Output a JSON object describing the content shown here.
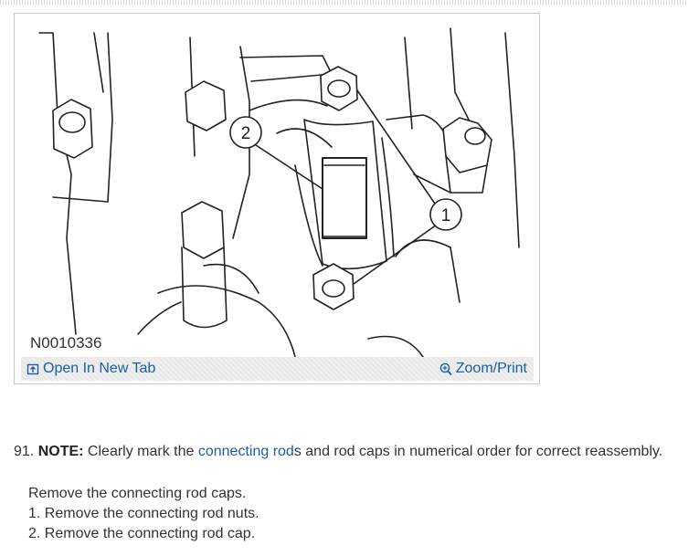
{
  "figure": {
    "image_id": "N0010336",
    "callouts": [
      "1",
      "2"
    ],
    "open_link": "Open In New Tab",
    "zoom_link": "Zoom/Print"
  },
  "step": {
    "number": "91.",
    "note_label": "NOTE:",
    "text_before": " Clearly mark the ",
    "link_text": "connecting rod",
    "text_after": "s and rod caps in numerical order for correct reassembly."
  },
  "instructions": {
    "intro": "Remove the connecting rod caps.",
    "items": [
      "1. Remove the connecting rod nuts.",
      "2. Remove the connecting rod cap."
    ]
  },
  "colors": {
    "link": "#1a5fa8",
    "text": "#333333"
  },
  "icons": {
    "open": "open-new-tab-icon",
    "zoom": "magnifier-plus-icon"
  }
}
